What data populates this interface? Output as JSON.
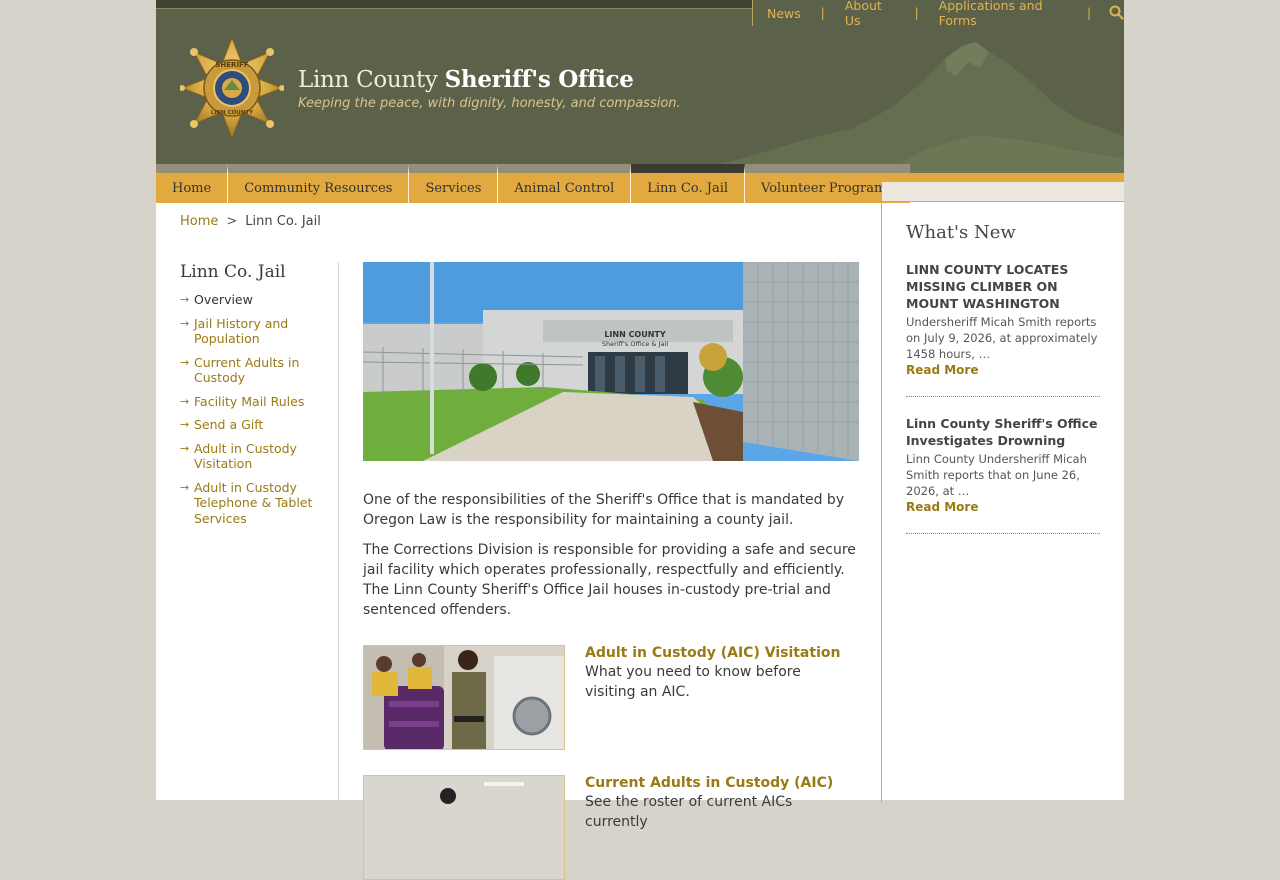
{
  "utility_nav": {
    "items": [
      "News",
      "About Us",
      "Applications and Forms"
    ],
    "separator": "|",
    "search_icon": "search-icon"
  },
  "header": {
    "title_light": "Linn County",
    "title_bold": "Sheriff's Office",
    "tagline": "Keeping the peace, with dignity, honesty, and compassion.",
    "badge_top": "SHERIFF",
    "badge_bottom": "LINN COUNTY"
  },
  "main_nav": {
    "items": [
      "Home",
      "Community Resources",
      "Services",
      "Animal Control",
      "Linn Co. Jail",
      "Volunteer Programs"
    ],
    "active": "Linn Co. Jail"
  },
  "breadcrumb": {
    "home": "Home",
    "separator": ">",
    "current": "Linn Co. Jail"
  },
  "sidebar": {
    "title": "Linn Co. Jail",
    "items": [
      {
        "label": "Overview",
        "current": true
      },
      {
        "label": "Jail History and Population"
      },
      {
        "label": "Current Adults in Custody"
      },
      {
        "label": "Facility Mail Rules"
      },
      {
        "label": "Send a Gift"
      },
      {
        "label": "Adult in Custody Visitation"
      },
      {
        "label": "Adult in Custody Telephone & Tablet Services"
      }
    ]
  },
  "main": {
    "hero_sign": "LINN COUNTY Sheriff's Office & Jail",
    "paragraph1": "One of the responsibilities of the Sheriff's Office that is mandated by Oregon Law is the responsibility for maintaining a county jail.",
    "paragraph2": "The Corrections Division is responsible for providing a safe and secure jail facility which operates professionally, respectfully and efficiently. The Linn County Sheriff's Office Jail houses in-custody pre-trial and sentenced offenders.",
    "cards": [
      {
        "title": "Adult in Custody (AIC) Visitation",
        "desc": "What you need to know before visiting an AIC."
      },
      {
        "title": "Current Adults in Custody (AIC)",
        "desc": "See the roster of current AICs currently"
      }
    ]
  },
  "whats_new": {
    "heading": "What's New",
    "items": [
      {
        "title": "LINN COUNTY LOCATES MISSING CLIMBER ON MOUNT WASHINGTON",
        "body": "Undersheriff Micah Smith reports on July 9, 2026, at approximately 1458 hours, …",
        "more": "Read More"
      },
      {
        "title": "Linn County Sheriff's Office Investigates Drowning",
        "body": "Linn County Undersheriff Micah Smith reports that on June 26, 2026, at …",
        "more": "Read More"
      }
    ]
  },
  "colors": {
    "header_bg": "#5b6249",
    "accent_gold": "#e1a940",
    "link_gold": "#9a7a14"
  }
}
